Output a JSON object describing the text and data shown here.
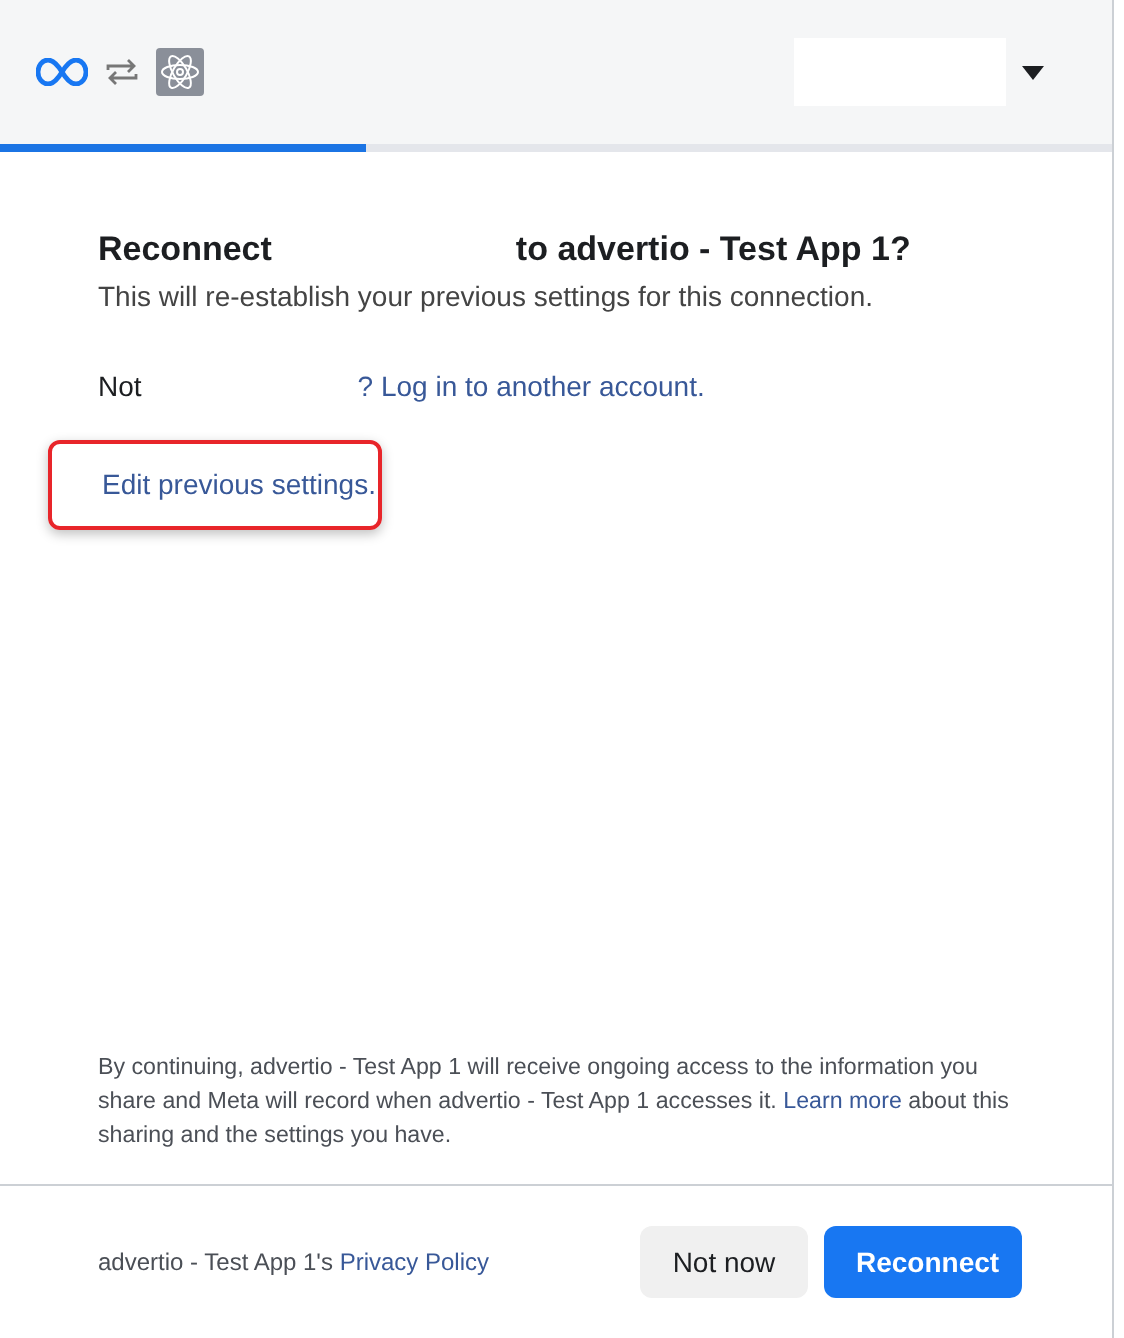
{
  "header": {
    "progress": {
      "level": 0.33
    }
  },
  "title": {
    "start": "Reconnect",
    "end": "to advertio - Test App 1?"
  },
  "subtitle": "This will re-establish your previous settings for this connection.",
  "account_line": {
    "prefix": "Not",
    "link": "? Log in to another account."
  },
  "edit_link": {
    "text": "Edit previous settings.",
    "highlighted": true
  },
  "notice": {
    "before": "By continuing, advertio - Test App 1 will receive ongoing access to the information you share and Meta will record when advertio - Test App 1 accesses it.",
    "link": "Learn more",
    "after": "about this sharing and the settings you have."
  },
  "footer": {
    "policy_prefix": "advertio - Test App 1's",
    "policy_link": "Privacy Policy",
    "buttons": [
      {
        "label": "Not now",
        "kind": "secondary"
      },
      {
        "label": "Reconnect",
        "kind": "primary"
      }
    ]
  }
}
